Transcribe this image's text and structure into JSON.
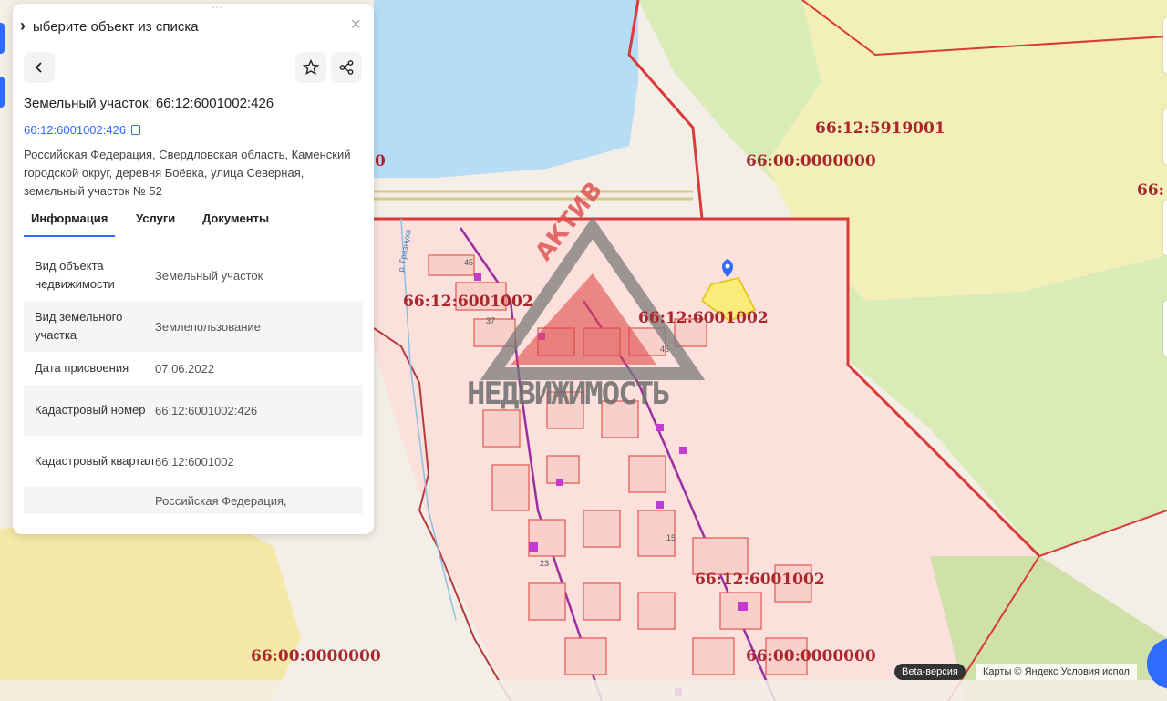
{
  "panel": {
    "header_text": "ыберите объект из списка",
    "object_title": "Земельный участок: 66:12:6001002:426",
    "cad_link": "66:12:6001002:426",
    "address": "Российская Федерация, Свердловская область, Каменский городской округ, деревня Боёвка, улица Северная, земельный участок № 52",
    "tabs": [
      "Информация",
      "Услуги",
      "Документы"
    ],
    "rows": [
      {
        "key": "Вид объекта недвижимости",
        "value": "Земельный участок"
      },
      {
        "key": "Вид земельного участка",
        "value": "Землепользование"
      },
      {
        "key": "Дата присвоения",
        "value": "07.06.2022"
      },
      {
        "key": "Кадастровый номер",
        "value": "66:12:6001002:426"
      },
      {
        "key": "Кадастровый квартал",
        "value": "66:12:6001002"
      },
      {
        "key": "",
        "value": "Российская Федерация,"
      }
    ]
  },
  "map": {
    "labels": [
      "66:12:5919001",
      "66:00:0000000",
      "66:",
      "66:12:6001002",
      "66:12:6001002",
      "66:12:6001002",
      "66:00:0000000",
      "66:00:0000000",
      "0"
    ],
    "parcel_numbers": [
      "45",
      "37",
      "46",
      "15",
      "23"
    ],
    "river_label": "р. Грязнуха",
    "watermark_top": "АКТИВ",
    "watermark_bottom": "НЕДВИЖИМОСТЬ",
    "colors": {
      "boundary": "#d93a3a",
      "water": "#b7dcf5",
      "forest": "#d9ecb7",
      "yellow": "#fff3b0",
      "pink": "#fbe0dc",
      "accent": "#2f6bff"
    }
  },
  "footer": {
    "beta": "Beta-версия",
    "attribution": "Карты © Яндекс  Условия испол"
  }
}
